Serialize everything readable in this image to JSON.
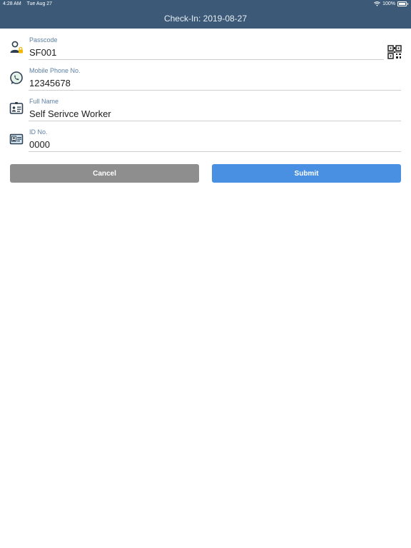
{
  "status_bar": {
    "time": "4:28 AM",
    "date": "Tue Aug 27",
    "battery": "100%"
  },
  "header": {
    "title": "Check-In: 2019-08-27",
    "color": "#3c5a78"
  },
  "form": {
    "passcode": {
      "label": "Passcode",
      "value": "SF001",
      "icon": "user-lock-icon"
    },
    "mobile": {
      "label": "Mobile Phone No.",
      "value": "12345678",
      "icon": "whatsapp-icon"
    },
    "full_name": {
      "label": "Full Name",
      "value": "Self Serivce Worker",
      "icon": "id-card-icon"
    },
    "id_no": {
      "label": "ID No.",
      "value": "0000",
      "icon": "id-photo-icon"
    },
    "qr_icon": "qr-code-icon"
  },
  "buttons": {
    "cancel_label": "Cancel",
    "submit_label": "Submit",
    "cancel_color": "#8e8e8e",
    "submit_color": "#4a90e2"
  }
}
